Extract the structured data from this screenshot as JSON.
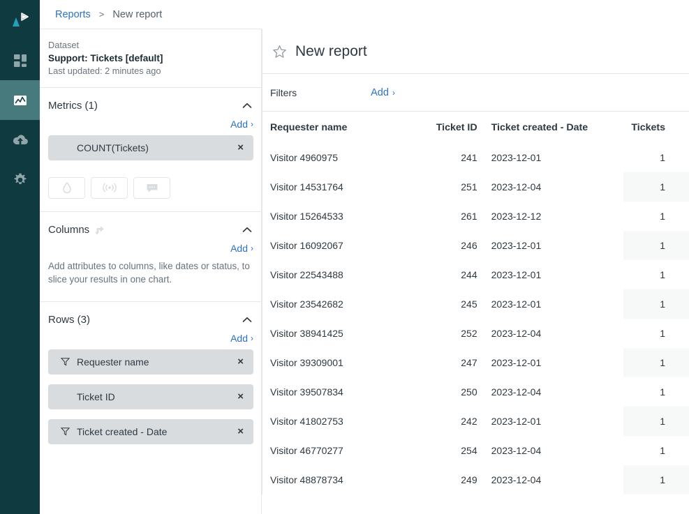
{
  "rail": {
    "logo_icon": "play-triangle-logo",
    "items": [
      {
        "name": "dashboard",
        "icon": "grid-squares-icon",
        "active": false
      },
      {
        "name": "reports",
        "icon": "line-chart-icon",
        "active": true
      },
      {
        "name": "upload",
        "icon": "cloud-upload-icon",
        "active": false
      },
      {
        "name": "settings",
        "icon": "gear-icon",
        "active": false
      }
    ]
  },
  "breadcrumb": {
    "link": "Reports",
    "separator": ">",
    "current": "New report"
  },
  "dataset": {
    "label": "Dataset",
    "name": "Support: Tickets [default]",
    "updated": "Last updated: 2 minutes ago"
  },
  "metrics": {
    "title": "Metrics (1)",
    "add_label": "Add",
    "add_chevron": "›",
    "collapse_icon": "chevron-up-icon",
    "chips": [
      {
        "label": "COUNT(Tickets)",
        "filtered": false,
        "remove": "×"
      }
    ],
    "tool_buttons": [
      {
        "icon": "droplet-icon"
      },
      {
        "icon": "signal-broadcast-icon"
      },
      {
        "icon": "comment-bubble-icon"
      }
    ]
  },
  "columns": {
    "title": "Columns",
    "drag_icon": "move-arrow-icon",
    "add_label": "Add",
    "add_chevron": "›",
    "collapse_icon": "chevron-up-icon",
    "help": "Add attributes to columns, like dates or status, to slice your results in one chart."
  },
  "rows": {
    "title": "Rows (3)",
    "add_label": "Add",
    "add_chevron": "›",
    "collapse_icon": "chevron-up-icon",
    "chips": [
      {
        "label": "Requester name",
        "filtered": true,
        "remove": "×"
      },
      {
        "label": "Ticket ID",
        "filtered": false,
        "remove": "×"
      },
      {
        "label": "Ticket created - Date",
        "filtered": true,
        "remove": "×"
      }
    ]
  },
  "report": {
    "star_icon": "star-outline-icon",
    "title": "New report",
    "filters_label": "Filters",
    "filters_add_label": "Add",
    "filters_add_chevron": "›"
  },
  "chart_data": {
    "type": "table",
    "title": "New report",
    "columns": [
      "Requester name",
      "Ticket ID",
      "Ticket created - Date",
      "Tickets"
    ],
    "rows": [
      [
        "Visitor 4960975",
        "241",
        "2023-12-01",
        "1"
      ],
      [
        "Visitor 14531764",
        "251",
        "2023-12-04",
        "1"
      ],
      [
        "Visitor 15264533",
        "261",
        "2023-12-12",
        "1"
      ],
      [
        "Visitor 16092067",
        "246",
        "2023-12-01",
        "1"
      ],
      [
        "Visitor 22543488",
        "244",
        "2023-12-01",
        "1"
      ],
      [
        "Visitor 23542682",
        "245",
        "2023-12-01",
        "1"
      ],
      [
        "Visitor 38941425",
        "252",
        "2023-12-04",
        "1"
      ],
      [
        "Visitor 39309001",
        "247",
        "2023-12-01",
        "1"
      ],
      [
        "Visitor 39507834",
        "250",
        "2023-12-04",
        "1"
      ],
      [
        "Visitor 41802753",
        "242",
        "2023-12-01",
        "1"
      ],
      [
        "Visitor 46770277",
        "254",
        "2023-12-04",
        "1"
      ],
      [
        "Visitor 48878734",
        "249",
        "2023-12-04",
        "1"
      ]
    ]
  },
  "colors": {
    "rail_bg": "#0f3a40",
    "rail_active": "#467a7d",
    "logo_accent": "#25a0b8",
    "link_blue": "#2a72c4",
    "chip_bg": "#d8dcdf",
    "text_dark": "#2f3941",
    "text_muted": "#68737d",
    "alt_cell": "#f7f9f9"
  }
}
